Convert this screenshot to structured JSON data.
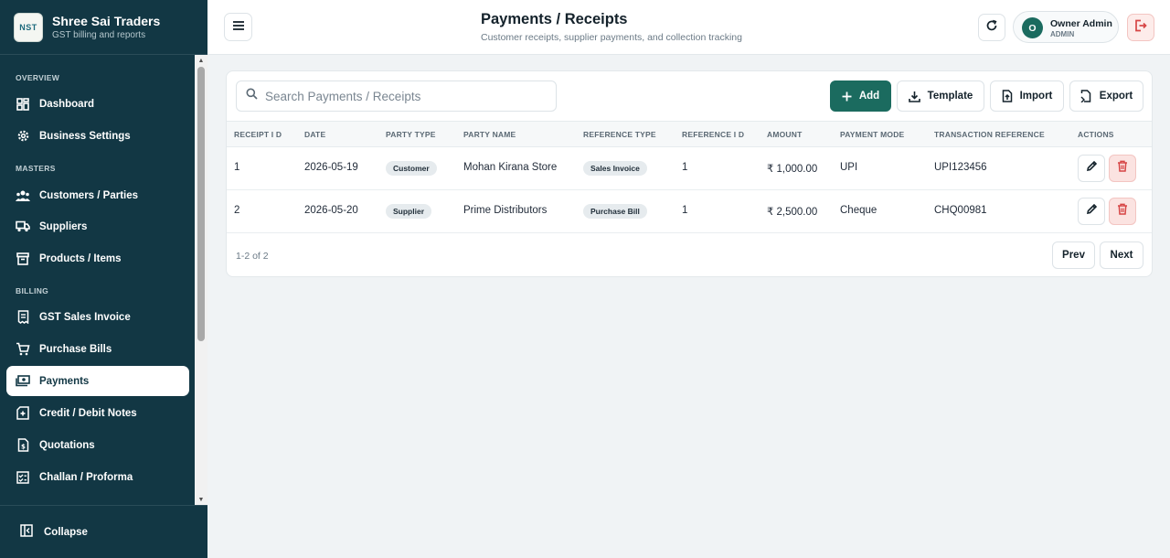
{
  "brand": {
    "name": "Shree Sai Traders",
    "subtitle": "GST billing and reports",
    "logo_text": "NST"
  },
  "sidebar": {
    "sections": [
      "OVERVIEW",
      "MASTERS",
      "BILLING"
    ],
    "items": [
      {
        "label": "Dashboard",
        "icon": "dashboard-icon"
      },
      {
        "label": "Business Settings",
        "icon": "gear-icon"
      },
      {
        "label": "Customers / Parties",
        "icon": "users-icon"
      },
      {
        "label": "Suppliers",
        "icon": "truck-icon"
      },
      {
        "label": "Products / Items",
        "icon": "archive-box-icon"
      },
      {
        "label": "GST Sales Invoice",
        "icon": "receipt-icon"
      },
      {
        "label": "Purchase Bills",
        "icon": "cart-icon"
      },
      {
        "label": "Payments",
        "icon": "cash-icon",
        "active": true
      },
      {
        "label": "Credit / Debit Notes",
        "icon": "note-plus-icon"
      },
      {
        "label": "Quotations",
        "icon": "quotation-icon"
      },
      {
        "label": "Challan / Proforma",
        "icon": "checklist-icon"
      }
    ],
    "collapse_label": "Collapse"
  },
  "header": {
    "title": "Payments / Receipts",
    "subtitle": "Customer receipts, supplier payments, and collection tracking",
    "user": {
      "initial": "O",
      "name": "Owner Admin",
      "role": "ADMIN"
    }
  },
  "toolbar": {
    "search_placeholder": "Search Payments / Receipts",
    "add_label": "Add",
    "template_label": "Template",
    "import_label": "Import",
    "export_label": "Export"
  },
  "table": {
    "columns": [
      "RECEIPT I D",
      "DATE",
      "PARTY TYPE",
      "PARTY NAME",
      "REFERENCE TYPE",
      "REFERENCE I D",
      "AMOUNT",
      "PAYMENT MODE",
      "TRANSACTION REFERENCE",
      "ACTIONS"
    ],
    "rows": [
      {
        "receipt_id": "1",
        "date": "2026-05-19",
        "party_type": "Customer",
        "party_name": "Mohan Kirana Store",
        "reference_type": "Sales Invoice",
        "reference_id": "1",
        "amount": "₹ 1,000.00",
        "payment_mode": "UPI",
        "transaction_reference": "UPI123456"
      },
      {
        "receipt_id": "2",
        "date": "2026-05-20",
        "party_type": "Supplier",
        "party_name": "Prime Distributors",
        "reference_type": "Purchase Bill",
        "reference_id": "1",
        "amount": "₹ 2,500.00",
        "payment_mode": "Cheque",
        "transaction_reference": "CHQ00981"
      }
    ]
  },
  "pagination": {
    "summary": "1-2 of 2",
    "prev_label": "Prev",
    "next_label": "Next"
  },
  "colors": {
    "sidebar_bg": "#123744",
    "accent": "#1b6b5f",
    "danger": "#d64545"
  }
}
